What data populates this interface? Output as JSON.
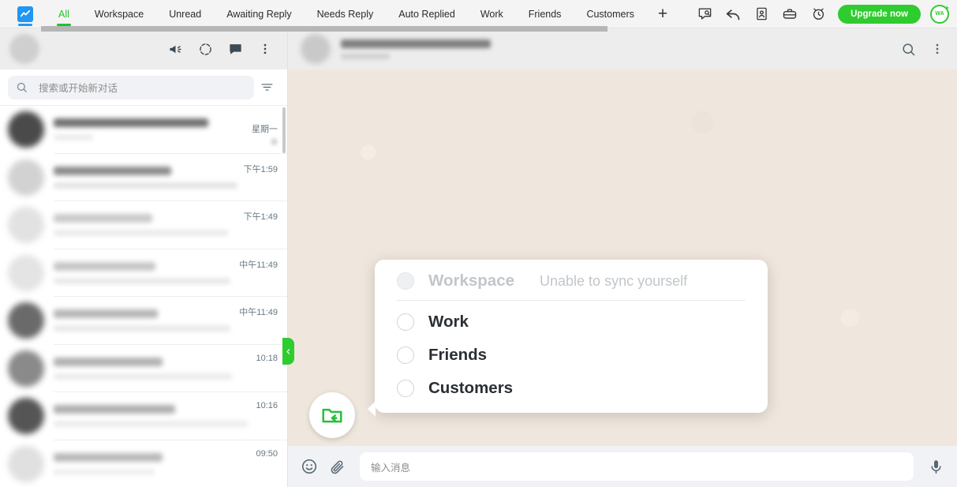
{
  "topbar": {
    "logo_icon": "chart-logo-icon",
    "tabs": [
      {
        "label": "All",
        "active": true
      },
      {
        "label": "Workspace",
        "active": false
      },
      {
        "label": "Unread",
        "active": false
      },
      {
        "label": "Awaiting Reply",
        "active": false
      },
      {
        "label": "Needs Reply",
        "active": false
      },
      {
        "label": "Auto Replied",
        "active": false
      },
      {
        "label": "Work",
        "active": false
      },
      {
        "label": "Friends",
        "active": false
      },
      {
        "label": "Customers",
        "active": false
      }
    ],
    "add_tab_label": "+",
    "icons": [
      "message-search-icon",
      "reply-arrow-icon",
      "contact-card-icon",
      "briefcase-icon",
      "alarm-clock-icon"
    ],
    "upgrade_label": "Upgrade now",
    "account_badge": "WA",
    "accent_green": "#2ecc2e",
    "logo_blue": "#2196f3"
  },
  "sidebar": {
    "header_icons": [
      "megaphone-icon",
      "status-ring-icon",
      "new-chat-icon",
      "overflow-menu-icon"
    ],
    "search": {
      "placeholder": "搜索或开始新对话",
      "search_icon": "search-icon",
      "filter_icon": "filter-icon"
    },
    "chats": [
      {
        "time": "星期一",
        "avatar_color": "#4a4a4a",
        "name_color": "#6f6f6f",
        "has_badge": true
      },
      {
        "time": "下午1:59",
        "avatar_color": "#d2d2d2",
        "name_color": "#8a8a8a",
        "has_badge": false
      },
      {
        "time": "下午1:49",
        "avatar_color": "#e2e2e2",
        "name_color": "#c9c9c9",
        "has_badge": false
      },
      {
        "time": "中午11:49",
        "avatar_color": "#e4e4e4",
        "name_color": "#c5c5c5",
        "has_badge": false
      },
      {
        "time": "中午11:49",
        "avatar_color": "#6a6a6a",
        "name_color": "#b5b5b5",
        "has_badge": false
      },
      {
        "time": "10:18",
        "avatar_color": "#8a8a8a",
        "name_color": "#b0b0b0",
        "has_badge": false
      },
      {
        "time": "10:16",
        "avatar_color": "#555555",
        "name_color": "#aeaeae",
        "has_badge": false
      },
      {
        "time": "09:50",
        "avatar_color": "#e0e0e0",
        "name_color": "#b8b8b8",
        "has_badge": false
      }
    ],
    "collapse_handle_icon": "chevron-left-icon"
  },
  "chat": {
    "header_icons": [
      "search-icon",
      "overflow-menu-icon"
    ],
    "background_color": "#efe7dd",
    "input": {
      "placeholder": "输入消息",
      "emoji_icon": "emoji-smiley-icon",
      "attach_icon": "paperclip-icon",
      "mic_icon": "microphone-icon"
    }
  },
  "folder_popup": {
    "fab_icon": "folder-move-icon",
    "options": [
      {
        "label": "Workspace",
        "note": "Unable to sync yourself",
        "disabled": true,
        "selected": false
      },
      {
        "label": "Work",
        "note": "",
        "disabled": false,
        "selected": false
      },
      {
        "label": "Friends",
        "note": "",
        "disabled": false,
        "selected": false
      },
      {
        "label": "Customers",
        "note": "",
        "disabled": false,
        "selected": false
      }
    ]
  }
}
